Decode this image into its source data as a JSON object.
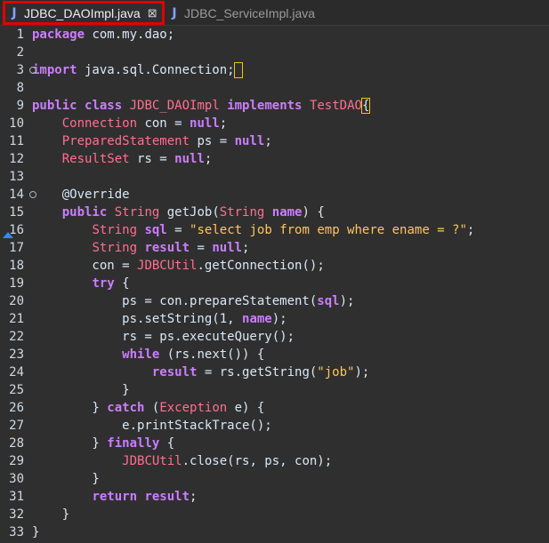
{
  "tabs": [
    {
      "label": "JDBC_DAOImpl.java",
      "active": true,
      "close_icon": "close-icon"
    },
    {
      "label": "JDBC_ServiceImpl.java",
      "active": false
    }
  ],
  "code_lines": [
    {
      "number": "1",
      "text": "package com.my.dao;"
    },
    {
      "number": "2",
      "text": ""
    },
    {
      "number": "3",
      "text": "import java.sql.Connection;"
    },
    {
      "number": "8",
      "text": ""
    },
    {
      "number": "9",
      "text": "public class JDBC_DAOImpl implements TestDAO{"
    },
    {
      "number": "10",
      "text": "    Connection con = null;"
    },
    {
      "number": "11",
      "text": "    PreparedStatement ps = null;"
    },
    {
      "number": "12",
      "text": "    ResultSet rs = null;"
    },
    {
      "number": "13",
      "text": ""
    },
    {
      "number": "14",
      "text": "    @Override"
    },
    {
      "number": "15",
      "text": "    public String getJob(String name) {"
    },
    {
      "number": "16",
      "text": "        String sql = \"select job from emp where ename = ?\";"
    },
    {
      "number": "17",
      "text": "        String result = null;"
    },
    {
      "number": "18",
      "text": "        con = JDBCUtil.getConnection();"
    },
    {
      "number": "19",
      "text": "        try {"
    },
    {
      "number": "20",
      "text": "            ps = con.prepareStatement(sql);"
    },
    {
      "number": "21",
      "text": "            ps.setString(1, name);"
    },
    {
      "number": "22",
      "text": "            rs = ps.executeQuery();"
    },
    {
      "number": "23",
      "text": "            while (rs.next()) {"
    },
    {
      "number": "24",
      "text": "                result = rs.getString(\"job\");"
    },
    {
      "number": "25",
      "text": "            }"
    },
    {
      "number": "26",
      "text": "        } catch (Exception e) {"
    },
    {
      "number": "27",
      "text": "            e.printStackTrace();"
    },
    {
      "number": "28",
      "text": "        } finally {"
    },
    {
      "number": "29",
      "text": "            JDBCUtil.close(rs, ps, con);"
    },
    {
      "number": "30",
      "text": "        }"
    },
    {
      "number": "31",
      "text": "        return result;"
    },
    {
      "number": "32",
      "text": "    }"
    },
    {
      "number": "33",
      "text": "}"
    }
  ],
  "colors": {
    "keyword": "#cc7dff",
    "type": "#ff6f91",
    "string": "#ffc65c",
    "text": "#d9e8f7",
    "active_tab_outline": "#e30000",
    "marker": "#3d83ff"
  },
  "icons": {
    "java_file": "java-file-icon",
    "override_marker": "override-marker-icon",
    "fold": "fold-icon"
  }
}
